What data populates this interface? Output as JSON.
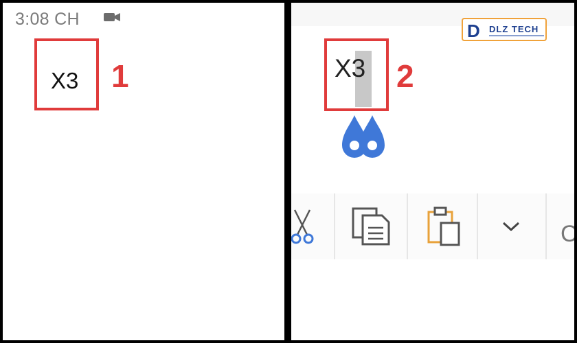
{
  "left_panel": {
    "status_time": "3:08 CH",
    "status_icon": "video-camera-icon",
    "typed_text": "X3",
    "step_label": "1"
  },
  "right_panel": {
    "logo": {
      "brand": "DLZ TECH",
      "icon": "d-logo-icon"
    },
    "typed_text": "X3",
    "selected_char": "3",
    "step_label": "2",
    "selection_handle_icon": "text-selection-handles-icon",
    "toolbar": {
      "items": [
        {
          "name": "cut",
          "icon": "scissors-icon"
        },
        {
          "name": "copy",
          "icon": "copy-icon"
        },
        {
          "name": "paste",
          "icon": "paste-icon"
        },
        {
          "name": "more",
          "icon": "chevron-down-icon"
        }
      ],
      "trailing_text": "C"
    }
  },
  "colors": {
    "highlight_red": "#e03b3b",
    "selection_handle_blue": "#3f78d8",
    "selection_gray": "#c8c8c8",
    "logo_border": "#f0a23a"
  }
}
